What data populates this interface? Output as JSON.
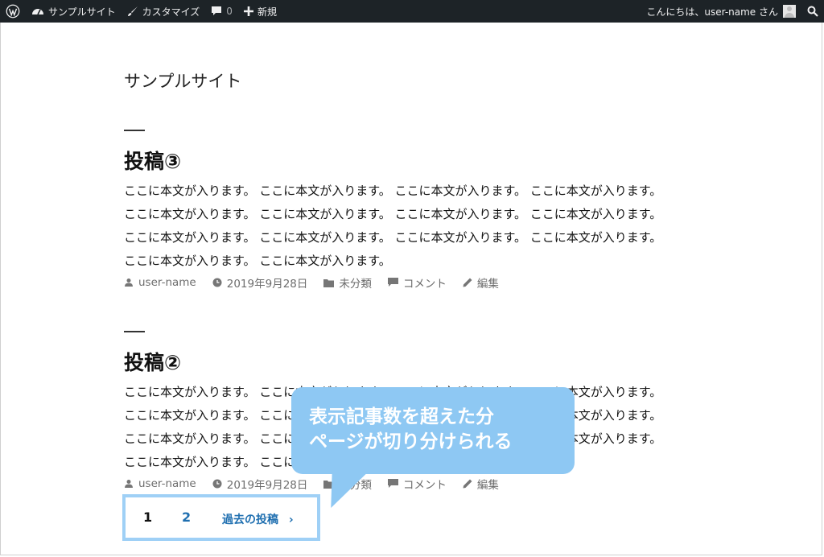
{
  "adminbar": {
    "site_name": "サンプルサイト",
    "customize": "カスタマイズ",
    "comments_count": "0",
    "new": "新規",
    "greeting": "こんにちは、user-name さん"
  },
  "site": {
    "title": "サンプルサイト"
  },
  "posts": [
    {
      "title": "投稿③",
      "body": "ここに本文が入ります。 ここに本文が入ります。 ここに本文が入ります。 ここに本文が入ります。 ここに本文が入ります。 ここに本文が入ります。 ここに本文が入ります。 ここに本文が入ります。 ここに本文が入ります。 ここに本文が入ります。 ここに本文が入ります。 ここに本文が入ります。 ここに本文が入ります。 ここに本文が入ります。",
      "author": "user-name",
      "date": "2019年9月28日",
      "category": "未分類",
      "comment": "コメント",
      "edit": "編集"
    },
    {
      "title": "投稿②",
      "body": "ここに本文が入ります。 ここに本文が入ります。 ここに本文が入ります。 ここに本文が入ります。 ここに本文が入ります。 ここに本文が入ります。 ここに本文が入ります。 ここに本文が入ります。 ここに本文が入ります。 ここに本文が入ります。 ここに本文が入ります。 ここに本文が入ります。 ここに本文が入ります。 ここに本文が入ります。",
      "author": "user-name",
      "date": "2019年9月28日",
      "category": "未分類",
      "comment": "コメント",
      "edit": "編集"
    }
  ],
  "pagination": {
    "current": "1",
    "page2": "2",
    "next": "過去の投稿"
  },
  "callout": {
    "line1": "表示記事数を超えた分",
    "line2": "ページが切り分けられる"
  },
  "colors": {
    "adminbar_bg": "#1d2327",
    "link": "#1f6fb0",
    "highlight": "#9fd0f6",
    "callout": "#8ec8f3"
  }
}
